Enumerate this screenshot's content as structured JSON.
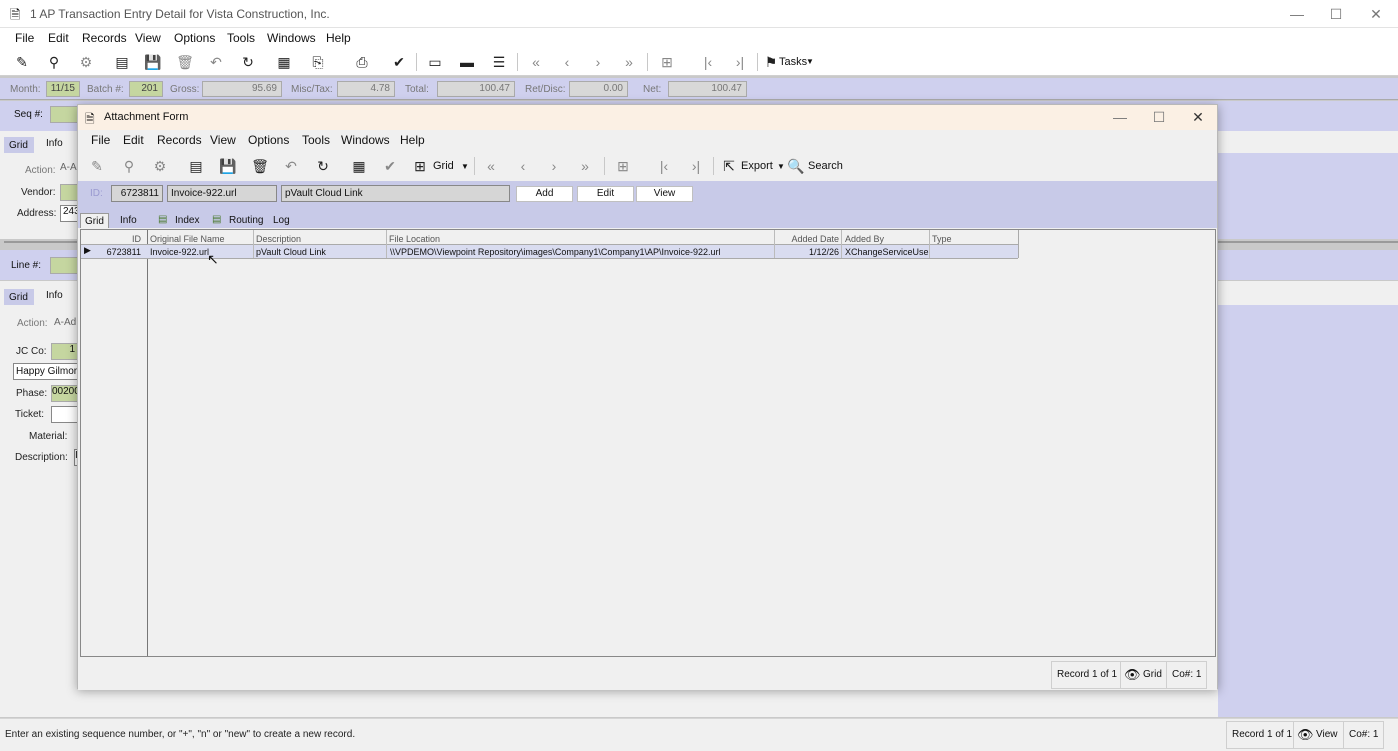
{
  "app": {
    "title": "1 AP Transaction Entry Detail for Vista Construction, Inc.",
    "menu": [
      "File",
      "Edit",
      "Records",
      "View",
      "Options",
      "Tools",
      "Windows",
      "Help"
    ],
    "tasks_label": "Tasks",
    "header": {
      "month_label": "Month:",
      "month_value": "11/15",
      "batch_label": "Batch #:",
      "batch_value": "201",
      "gross_label": "Gross:",
      "gross_value": "95.69",
      "misc_label": "Misc/Tax:",
      "misc_value": "4.78",
      "total_label": "Total:",
      "total_value": "100.47",
      "retdisc_label": "Ret/Disc:",
      "retdisc_value": "0.00",
      "net_label": "Net:",
      "net_value": "100.47"
    },
    "left": {
      "seq_label": "Seq #:",
      "tab_grid": "Grid",
      "tab_info": "Info",
      "action_label": "Action:",
      "action_value": "A-A",
      "vendor_label": "Vendor:",
      "address_label": "Address:",
      "address_value": "243",
      "line_label": "Line #:",
      "tab_grid2": "Grid",
      "tab_info2": "Info",
      "action2_label": "Action:",
      "action2_value": "A-Ad",
      "jcco_label": "JC Co:",
      "jcco_value": "1",
      "job_value": "Happy Gilmore",
      "phase_label": "Phase:",
      "phase_value": "00200",
      "ticket_label": "Ticket:",
      "material_label": "Material:",
      "description_label": "Description:",
      "description_value": "I"
    },
    "status": {
      "message": "Enter an existing sequence number, or \"+\", \"n\" or \"new\" to create a new record.",
      "record": "Record 1 of 1",
      "mode": "View",
      "company": "Co#: 1"
    }
  },
  "dialog": {
    "title": "Attachment Form",
    "menu": [
      "File",
      "Edit",
      "Records",
      "View",
      "Options",
      "Tools",
      "Windows",
      "Help"
    ],
    "toolbar": {
      "grid_label": "Grid",
      "export_label": "Export",
      "search_label": "Search"
    },
    "form": {
      "id_label": "ID:",
      "id_value": "6723811",
      "filename_value": "Invoice-922.url",
      "description_value": "pVault Cloud Link",
      "add_label": "Add",
      "edit_label": "Edit",
      "view_label": "View"
    },
    "tabs": [
      "Grid",
      "Info",
      "Index",
      "Routing",
      "Log"
    ],
    "grid": {
      "columns": [
        "ID",
        "Original File Name",
        "Description",
        "File Location",
        "Added Date",
        "Added By",
        "Type"
      ],
      "rows": [
        [
          "6723811",
          "Invoice-922.url",
          "pVault Cloud Link",
          "\\\\VPDEMO\\Viewpoint Repository\\images\\Company1\\Company1\\AP\\Invoice-922.url",
          "1/12/26",
          "XChangeServiceUser",
          ""
        ]
      ]
    },
    "status": {
      "record": "Record 1 of 1",
      "mode": "Grid",
      "company": "Co#: 1"
    }
  }
}
